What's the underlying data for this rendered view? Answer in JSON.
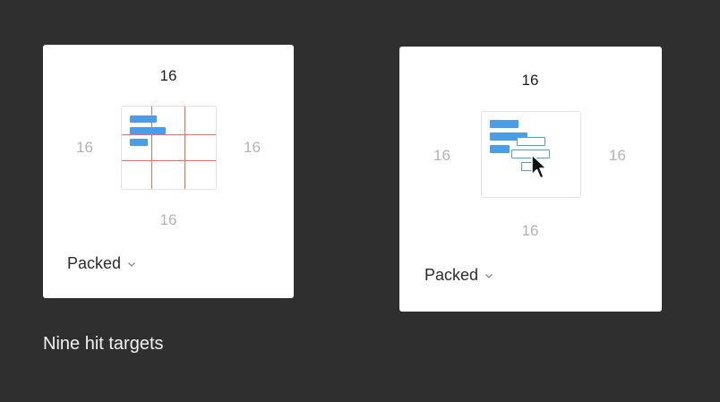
{
  "left_panel": {
    "padding_top": "16",
    "padding_left": "16",
    "padding_right": "16",
    "padding_bottom": "16",
    "spacing_mode": "Packed",
    "icon": "chevron-down-icon"
  },
  "right_panel": {
    "padding_top": "16",
    "padding_left": "16",
    "padding_right": "16",
    "padding_bottom": "16",
    "spacing_mode": "Packed",
    "icon": "chevron-down-icon"
  },
  "caption": "Nine hit targets",
  "colors": {
    "background": "#2f2f2f",
    "panel": "#ffffff",
    "accent_blue": "#4a9ee8",
    "guide_red": "#f26b4d"
  }
}
